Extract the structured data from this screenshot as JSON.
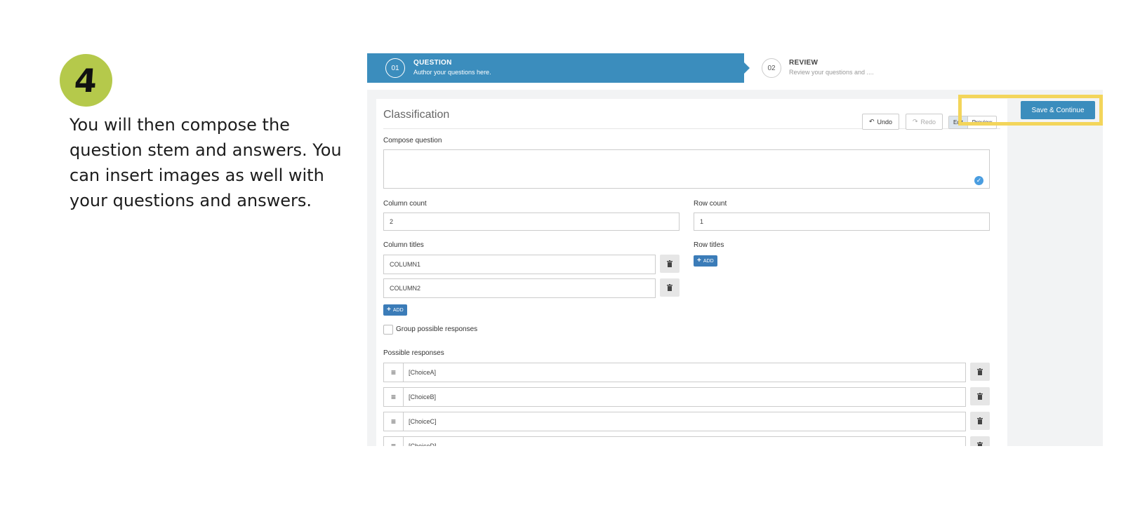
{
  "step": {
    "number": "4"
  },
  "instructions": "You will then compose the question stem and answers. You can insert images as well with your questions and answers.",
  "stepper": {
    "active": {
      "num": "01",
      "title": "QUESTION",
      "subtitle": "Author your questions here."
    },
    "inactive": {
      "num": "02",
      "title": "REVIEW",
      "subtitle": "Review your questions and ...."
    }
  },
  "card": {
    "title": "Classification"
  },
  "toolbar": {
    "undo": "Undo",
    "redo": "Redo",
    "edit": "Edit",
    "preview": "Preview",
    "save": "Save & Continue"
  },
  "labels": {
    "compose": "Compose question",
    "column_count": "Column count",
    "row_count": "Row count",
    "column_titles": "Column titles",
    "row_titles": "Row titles",
    "group": "Group possible responses",
    "possible": "Possible responses",
    "add": "ADD"
  },
  "values": {
    "column_count": "2",
    "row_count": "1"
  },
  "column_titles": [
    "COLUMN1",
    "COLUMN2"
  ],
  "responses": [
    "[ChoiceA]",
    "[ChoiceB]",
    "[ChoiceC]",
    "[ChoiceD]"
  ],
  "colors": {
    "accent": "#3b8dbd",
    "highlight": "#f3d55b",
    "badge": "#b5c94b"
  }
}
